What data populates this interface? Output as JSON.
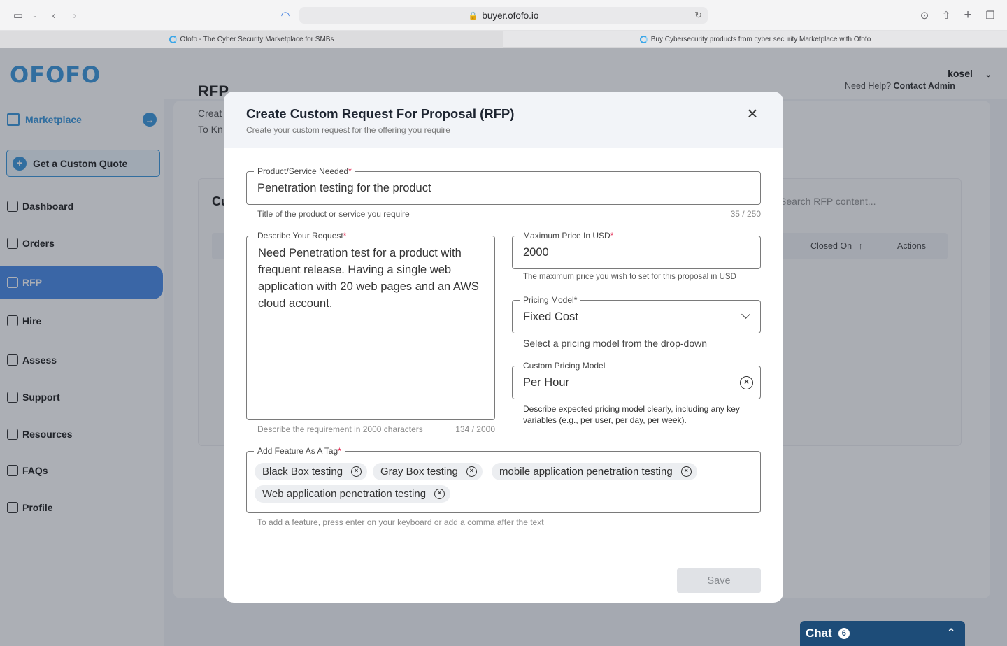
{
  "browser": {
    "url": "buyer.ofofo.io",
    "tabs": [
      {
        "title": "Ofofo - The Cyber Security Marketplace for SMBs"
      },
      {
        "title": "Buy Cybersecurity products from cyber security Marketplace with Ofofo"
      }
    ]
  },
  "app": {
    "logo": "OFOFO",
    "user": "kosel",
    "sidebar": {
      "marketplace": "Marketplace",
      "quote_button": "Get a Custom Quote",
      "items": [
        {
          "label": "Dashboard",
          "icon": "dashboard-icon"
        },
        {
          "label": "Orders",
          "icon": "box-icon"
        },
        {
          "label": "RFP",
          "icon": "person-icon"
        },
        {
          "label": "Hire",
          "icon": "briefcase-icon"
        },
        {
          "label": "Assess",
          "icon": "search-icon"
        },
        {
          "label": "Support",
          "icon": "headset-icon"
        },
        {
          "label": "Resources",
          "icon": "info-icon"
        },
        {
          "label": "FAQs",
          "icon": "question-icon"
        },
        {
          "label": "Profile",
          "icon": "user-circle-icon"
        }
      ]
    },
    "page": {
      "title": "RFP",
      "sub1": "Creat",
      "sub2": "To Kn",
      "help_prefix": "Need Help?",
      "help_link": "Contact Admin",
      "card_title": "Cu",
      "search_placeholder": "Search RFP content...",
      "columns": [
        "Closed On",
        "Actions"
      ]
    }
  },
  "modal": {
    "title": "Create Custom Request For Proposal (RFP)",
    "subtitle": "Create your custom request for the offering you require",
    "product": {
      "label": "Product/Service Needed",
      "value": "Penetration testing for the product",
      "helper": "Title of the product or service you require",
      "counter": "35 / 250"
    },
    "description": {
      "label": "Describe Your Request",
      "value": "Need Penetration test for a product with frequent release. Having a single web application with 20 web pages and an AWS cloud account.",
      "helper": "Describe the requirement in 2000 characters",
      "counter": "134 / 2000"
    },
    "max_price": {
      "label": "Maximum Price In USD",
      "value": "2000",
      "helper": "The maximum price you wish to set for this proposal in USD"
    },
    "pricing_model": {
      "label": "Pricing Model*",
      "value": "Fixed Cost",
      "helper": "Select a pricing model from the drop-down"
    },
    "custom_pricing": {
      "label": "Custom Pricing Model",
      "value": "Per Hour",
      "helper": "Describe expected pricing model clearly, including any key variables (e.g., per user, per day, per week)."
    },
    "tags": {
      "label": "Add Feature As A Tag",
      "items": [
        "Black Box testing",
        "Gray Box testing",
        "mobile application penetration testing",
        "Web application penetration testing"
      ],
      "helper": "To add a feature, press enter on your keyboard or add a comma after the text"
    },
    "save_label": "Save"
  },
  "chat": {
    "label": "Chat",
    "count": "6"
  },
  "colors": {
    "accent": "#2b8fd9",
    "active_nav": "#3b82e6",
    "chat": "#1d4c78"
  }
}
